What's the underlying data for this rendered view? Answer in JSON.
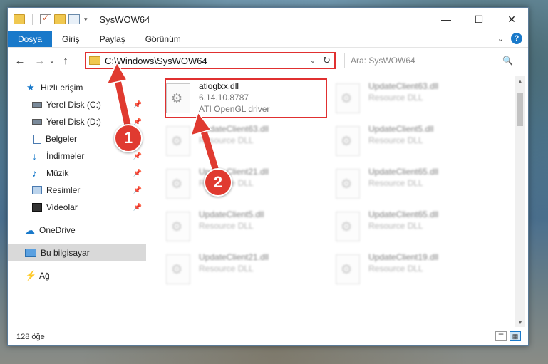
{
  "window": {
    "title": "SysWOW64",
    "controls": {
      "minimize": "—",
      "maximize": "☐",
      "close": "✕"
    }
  },
  "ribbon": {
    "tabs": [
      "Dosya",
      "Giriş",
      "Paylaş",
      "Görünüm"
    ],
    "active_tab": "Dosya",
    "help": "?",
    "expand": "⌄"
  },
  "address_bar": {
    "path": "C:\\Windows\\SysWOW64",
    "search_placeholder": "Ara: SysWOW64",
    "back": "←",
    "forward": "→",
    "recent": "⌄",
    "up": "↑",
    "dropdown": "⌄",
    "refresh": "↻",
    "search_icon": "🔍"
  },
  "sidebar": {
    "items": [
      {
        "label": "Hızlı erişim",
        "icon": "star-icon"
      },
      {
        "label": "Yerel Disk (C:)",
        "icon": "disk-icon",
        "pinned": true
      },
      {
        "label": "Yerel Disk (D:)",
        "icon": "disk-icon",
        "pinned": true
      },
      {
        "label": "Belgeler",
        "icon": "documents-icon",
        "pinned": true
      },
      {
        "label": "İndirmeler",
        "icon": "downloads-icon",
        "pinned": true
      },
      {
        "label": "Müzik",
        "icon": "music-icon",
        "pinned": true
      },
      {
        "label": "Resimler",
        "icon": "pictures-icon",
        "pinned": true
      },
      {
        "label": "Videolar",
        "icon": "videos-icon",
        "pinned": true
      },
      {
        "label": "OneDrive",
        "icon": "cloud-icon"
      },
      {
        "label": "Bu bilgisayar",
        "icon": "computer-icon",
        "selected": true
      },
      {
        "label": "Ağ",
        "icon": "network-icon"
      }
    ]
  },
  "files": {
    "highlighted": {
      "name": "atioglxx.dll",
      "version": "6.14.10.8787",
      "description": "ATI OpenGL driver"
    },
    "left_column": [
      {
        "name": "UpdateClient63.dll",
        "description": "Resource DLL"
      },
      {
        "name": "UpdateClient21.dll",
        "description": "Resource DLL"
      },
      {
        "name": "UpdateClient5.dll",
        "description": "Resource DLL"
      },
      {
        "name": "UpdateClient21.dll",
        "description": "Resource DLL"
      }
    ],
    "right_column": [
      {
        "name": "UpdateClient63.dll",
        "description": "Resource DLL"
      },
      {
        "name": "UpdateClient5.dll",
        "description": "Resource DLL"
      },
      {
        "name": "UpdateClient65.dll",
        "description": "Resource DLL"
      },
      {
        "name": "UpdateClient65.dll",
        "description": "Resource DLL"
      },
      {
        "name": "UpdateClient19.dll",
        "description": "Resource DLL"
      }
    ]
  },
  "status": {
    "count": "128 öğe"
  },
  "annotations": {
    "step1": "1",
    "step2": "2",
    "color": "#e03a30"
  }
}
